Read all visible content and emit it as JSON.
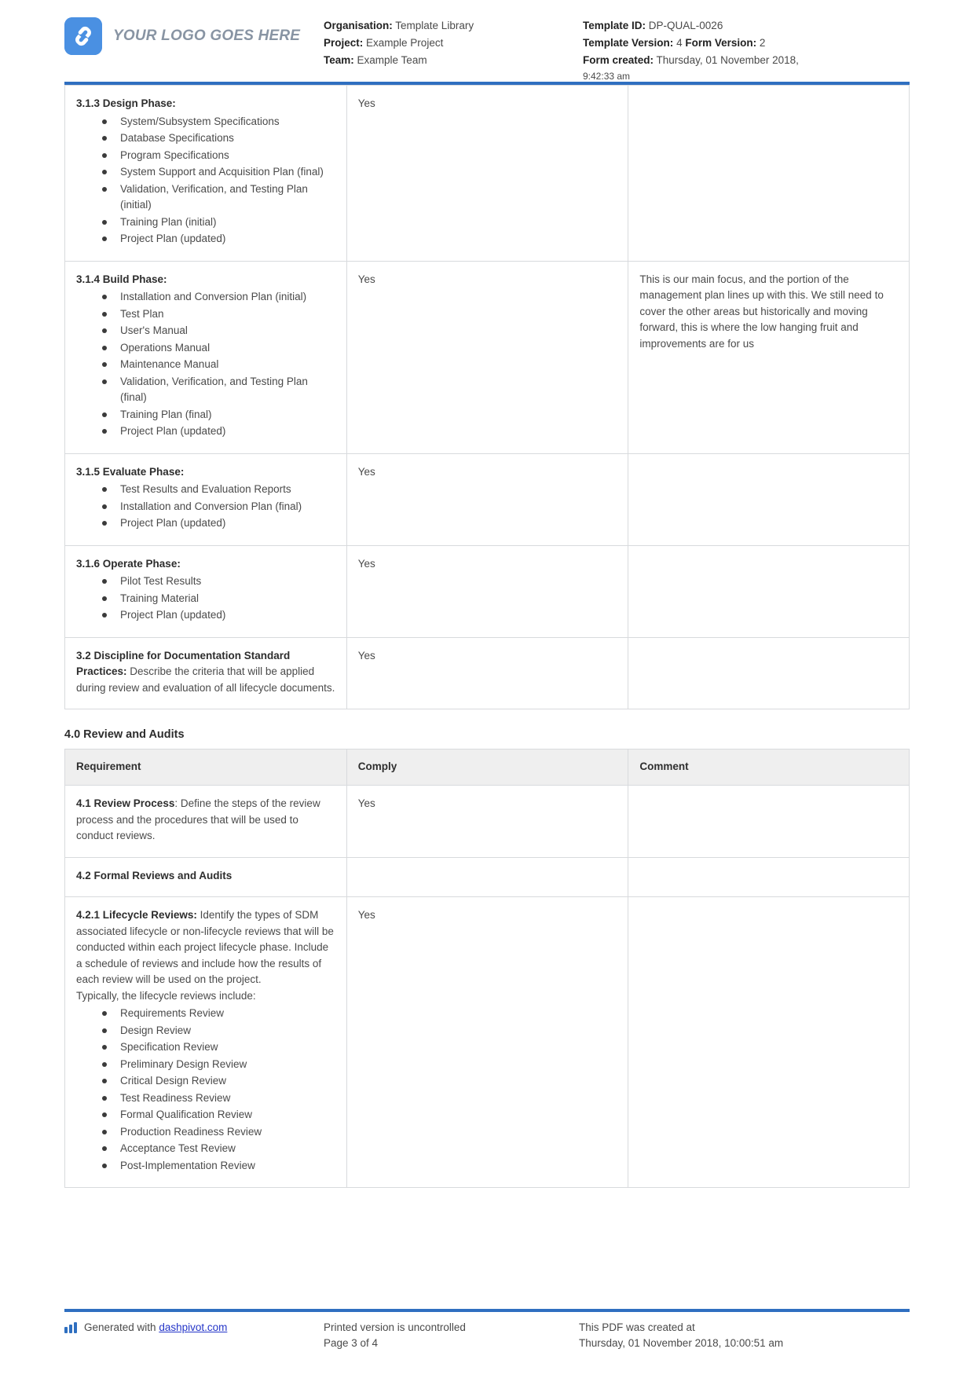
{
  "header": {
    "logo_text": "YOUR LOGO GOES HERE",
    "organisation_label": "Organisation:",
    "organisation_value": "Template Library",
    "project_label": "Project:",
    "project_value": "Example Project",
    "team_label": "Team:",
    "team_value": "Example Team",
    "template_id_label": "Template ID:",
    "template_id_value": "DP-QUAL-0026",
    "template_version_label": "Template Version:",
    "template_version_value": "4",
    "form_version_label": "Form Version:",
    "form_version_value": "2",
    "form_created_label": "Form created:",
    "form_created_value": "Thursday, 01 November 2018,",
    "form_created_time": "9:42:33 am"
  },
  "colors": {
    "accent_blue": "#2f6fc0",
    "logo_blue": "#4a90e2",
    "header_row_grey": "#efefef",
    "border_grey": "#d8dadd",
    "link_blue": "#2435c8"
  },
  "table_one": {
    "rows": [
      {
        "title": "3.1.3 Design Phase:",
        "bullets": [
          "System/Subsystem Specifications",
          "Database Specifications",
          "Program Specifications",
          "System Support and Acquisition Plan (final)",
          "Validation, Verification, and Testing Plan (initial)",
          "Training Plan (initial)",
          "Project Plan (updated)"
        ],
        "comply": "Yes",
        "comment": ""
      },
      {
        "title": "3.1.4 Build Phase:",
        "bullets": [
          "Installation and Conversion Plan (initial)",
          "Test Plan",
          "User's Manual",
          "Operations Manual",
          "Maintenance Manual",
          "Validation, Verification, and Testing Plan (final)",
          "Training Plan (final)",
          "Project Plan (updated)"
        ],
        "comply": "Yes",
        "comment": "This is our main focus, and the portion of the management plan lines up with this. We still need to cover the other areas but historically and moving forward, this is where the low hanging fruit and improvements are for us"
      },
      {
        "title": "3.1.5 Evaluate Phase:",
        "bullets": [
          "Test Results and Evaluation Reports",
          "Installation and Conversion Plan (final)",
          "Project Plan (updated)"
        ],
        "comply": "Yes",
        "comment": ""
      },
      {
        "title": "3.1.6 Operate Phase:",
        "bullets": [
          "Pilot Test Results",
          "Training Material",
          "Project Plan (updated)"
        ],
        "comply": "Yes",
        "comment": ""
      },
      {
        "title": "3.2 Discipline for Documentation Standard Practices:",
        "body": " Describe the criteria that will be applied during review and evaluation of all lifecycle documents.",
        "bullets": [],
        "comply": "Yes",
        "comment": ""
      }
    ]
  },
  "section_four": {
    "heading": "4.0 Review and Audits",
    "columns": [
      "Requirement",
      "Comply",
      "Comment"
    ],
    "rows": [
      {
        "title": "4.1 Review Process",
        "body": ": Define the steps of the review process and the procedures that will be used to conduct reviews.",
        "bullets": [],
        "comply": "Yes",
        "comment": ""
      },
      {
        "title": "4.2 Formal Reviews and Audits",
        "body": "",
        "bullets": [],
        "comply": "",
        "comment": ""
      },
      {
        "title": "4.2.1 Lifecycle Reviews:",
        "body": " Identify the types of SDM associated lifecycle or non-lifecycle reviews that will be conducted within each project lifecycle phase. Include a schedule of reviews and include how the results of each review will be used on the project.",
        "bullets_lead": "Typically, the lifecycle reviews include:",
        "bullets": [
          "Requirements Review",
          "Design Review",
          "Specification Review",
          "Preliminary Design Review",
          "Critical Design Review",
          "Test Readiness Review",
          "Formal Qualification Review",
          "Production Readiness Review",
          "Acceptance Test Review",
          "Post-Implementation Review"
        ],
        "comply": "Yes",
        "comment": ""
      }
    ]
  },
  "footer": {
    "generated_prefix": "Generated with ",
    "generated_link": "dashpivot.com",
    "printed_notice": "Printed version is uncontrolled",
    "page_number": "Page 3 of 4",
    "created_at_label": "This PDF was created at",
    "created_at_value": "Thursday, 01 November 2018, 10:00:51 am"
  }
}
